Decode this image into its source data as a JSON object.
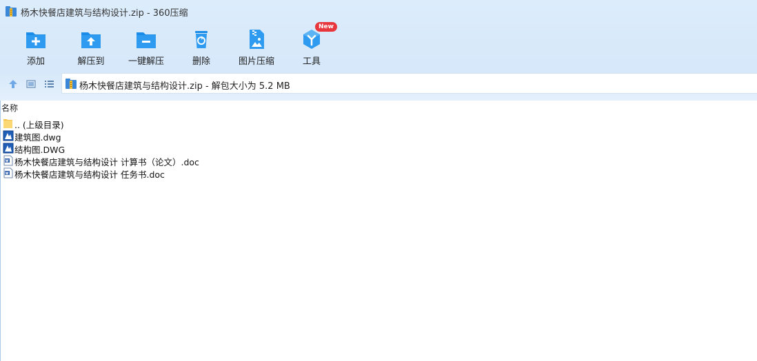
{
  "window": {
    "title": "杨木快餐店建筑与结构设计.zip - 360压缩"
  },
  "toolbar": {
    "items": [
      {
        "label": "添加",
        "icon": "add-folder-icon"
      },
      {
        "label": "解压到",
        "icon": "extract-to-icon"
      },
      {
        "label": "一键解压",
        "icon": "one-click-extract-icon"
      },
      {
        "label": "删除",
        "icon": "trash-icon"
      },
      {
        "label": "图片压缩",
        "icon": "image-compress-icon"
      },
      {
        "label": "工具",
        "icon": "tools-icon",
        "badge": "New"
      }
    ]
  },
  "address": {
    "text": "杨木快餐店建筑与结构设计.zip - 解包大小为 5.2 MB"
  },
  "list": {
    "column_name": "名称",
    "rows": [
      {
        "name": ".. (上级目录)",
        "icon": "folder-icon"
      },
      {
        "name": "建筑图.dwg",
        "icon": "dwg-file-icon"
      },
      {
        "name": "结构图.DWG",
        "icon": "dwg-file-icon"
      },
      {
        "name": "杨木快餐店建筑与结构设计 计算书（论文）.doc",
        "icon": "doc-file-icon"
      },
      {
        "name": "杨木快餐店建筑与结构设计 任务书.doc",
        "icon": "doc-file-icon"
      }
    ]
  },
  "colors": {
    "accent": "#1a8ce8",
    "chrome_bg": "#dcecfb",
    "badge_red": "#e8363d"
  }
}
